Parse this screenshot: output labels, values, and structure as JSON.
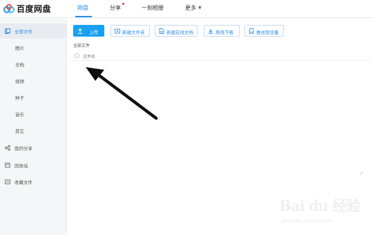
{
  "header": {
    "logo_text": "百度网盘",
    "nav": [
      {
        "label": "网盘"
      },
      {
        "label": "分享"
      },
      {
        "label": "一刻相册"
      },
      {
        "label": "更多"
      }
    ]
  },
  "sidebar": {
    "items": [
      {
        "label": "全部文件"
      },
      {
        "label": "图片"
      },
      {
        "label": "文档"
      },
      {
        "label": "视频"
      },
      {
        "label": "种子"
      },
      {
        "label": "音乐"
      },
      {
        "label": "其它"
      },
      {
        "label": "我的分享"
      },
      {
        "label": "回收站"
      },
      {
        "label": "收藏文件"
      }
    ]
  },
  "toolbar": {
    "upload": "上传",
    "new_folder": "新建文件夹",
    "new_doc": "新建在线文档",
    "offline_download": "离线下载",
    "push_device": "推送到设备"
  },
  "breadcrumb": "全部文件",
  "file_list": {
    "column_name": "文件名"
  },
  "watermark": {
    "main": "Bai du 经验",
    "sub": "jingyan.baidu.com"
  },
  "colors": {
    "accent": "#2a8ee8",
    "upload_bg": "#1aa0f0",
    "notification": "#e33333"
  }
}
